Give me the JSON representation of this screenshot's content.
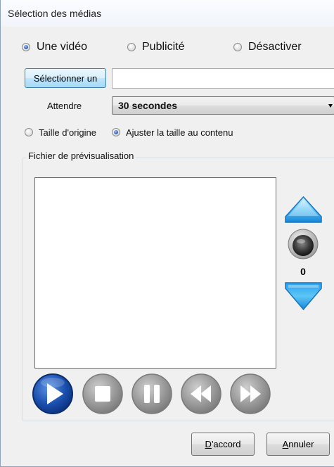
{
  "window": {
    "title": "Sélection des médias"
  },
  "mode": {
    "options": [
      {
        "label": "Une vidéo",
        "checked": true
      },
      {
        "label": "Publicité",
        "checked": false
      },
      {
        "label": "Désactiver",
        "checked": false
      }
    ]
  },
  "file": {
    "select_button": "Sélectionner un",
    "path_value": ""
  },
  "wait": {
    "label": "Attendre",
    "selected": "30 secondes"
  },
  "size": {
    "options": [
      {
        "label": "Taille d'origine",
        "checked": false
      },
      {
        "label": "Ajuster la taille au contenu",
        "checked": true
      }
    ]
  },
  "preview": {
    "group_label": "Fichier de prévisualisation",
    "volume": "0"
  },
  "controls": {
    "icons": [
      "play-icon",
      "stop-icon",
      "pause-icon",
      "rewind-icon",
      "fast-forward-icon"
    ],
    "side_icons": [
      "volume-up-icon",
      "speaker-icon",
      "volume-down-icon"
    ]
  },
  "footer": {
    "ok_mnemonic": "D",
    "ok_rest": "'accord",
    "cancel_mnemonic": "A",
    "cancel_rest": "nnuler"
  },
  "colors": {
    "accent_blue": "#1f5fbf",
    "arrow_blue": "#2aa5e8",
    "disabled_gray": "#9a9a9a"
  }
}
